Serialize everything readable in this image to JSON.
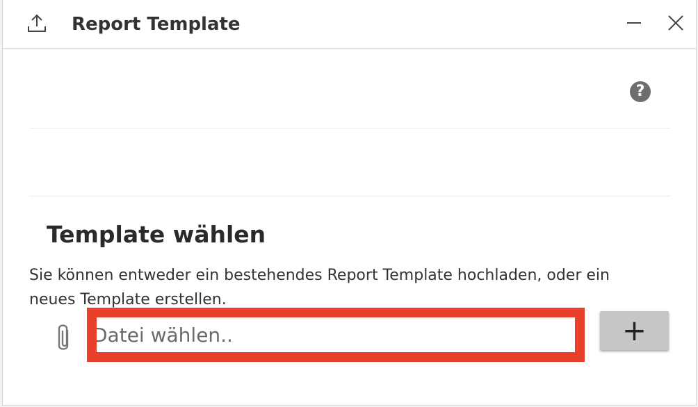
{
  "window": {
    "title": "Report Template",
    "upload_icon": "upload-icon",
    "minimize_icon": "minimize-icon",
    "close_icon": "close-icon"
  },
  "help": {
    "icon": "help-icon",
    "glyph": "?"
  },
  "template_section": {
    "heading": "Template wählen",
    "description": "Sie können entweder ein bestehendes Report Template hochladen, oder ein neues Template erstellen.",
    "file_input": {
      "placeholder": "Datei wählen..",
      "value": ""
    },
    "attach_icon": "paperclip-icon",
    "add_button_glyph": "+"
  },
  "colors": {
    "highlight": "#e8402a",
    "button_bg": "#c6c6c6",
    "help_bg": "#6e6e6e"
  }
}
